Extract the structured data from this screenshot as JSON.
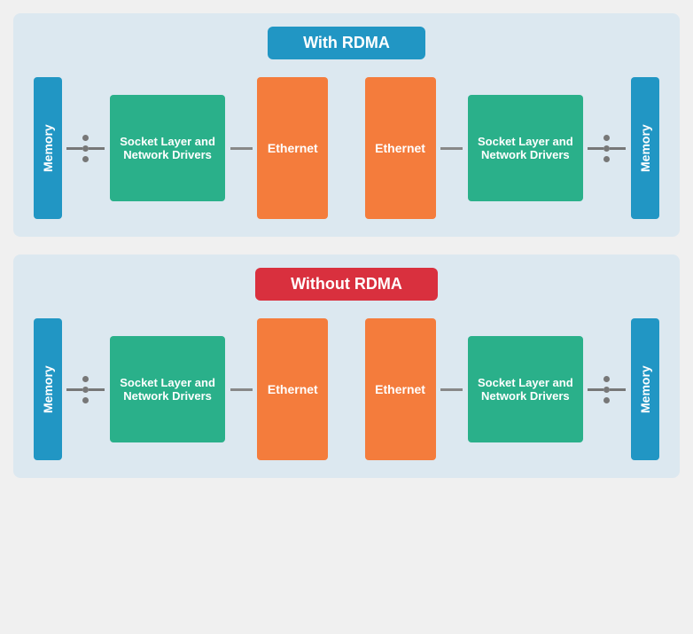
{
  "diagrams": [
    {
      "id": "with-rdma",
      "title": "With RDMA",
      "title_class": "title-rdma",
      "left_memory": "Memory",
      "right_memory": "Memory",
      "left_socket": "Socket Layer and Network Drivers",
      "left_ethernet": "Ethernet",
      "right_ethernet": "Ethernet",
      "right_socket": "Socket Layer and Network Drivers"
    },
    {
      "id": "without-rdma",
      "title": "Without RDMA",
      "title_class": "title-no-rdma",
      "left_memory": "Memory",
      "right_memory": "Memory",
      "left_socket": "Socket Layer and Network Drivers",
      "left_ethernet": "Ethernet",
      "right_ethernet": "Ethernet",
      "right_socket": "Socket Layer and Network Drivers"
    }
  ]
}
